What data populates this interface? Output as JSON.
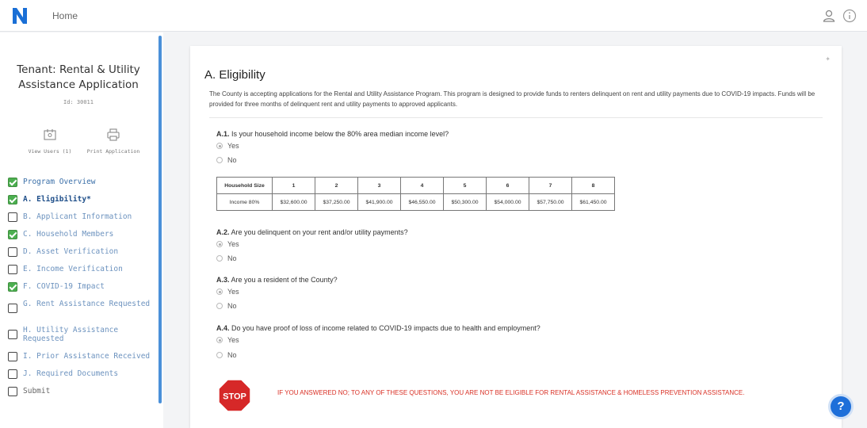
{
  "topbar": {
    "home_label": "Home",
    "user_icon": "user-icon",
    "info_icon": "info-icon",
    "logo_letter": "N"
  },
  "sidebar": {
    "title": "Tenant: Rental & Utility Assistance Application",
    "id_label": "Id: 30011",
    "actions": [
      {
        "label": "View Users (1)",
        "icon": "users-icon"
      },
      {
        "label": "Print Application",
        "icon": "print-icon"
      }
    ],
    "items": [
      {
        "label": "Program Overview",
        "checked": true
      },
      {
        "label": "A. Eligibility*",
        "checked": true,
        "active": true
      },
      {
        "label": "B. Applicant Information",
        "checked": false
      },
      {
        "label": "C. Household Members",
        "checked": true
      },
      {
        "label": "D. Asset Verification",
        "checked": false
      },
      {
        "label": "E. Income Verification",
        "checked": false
      },
      {
        "label": "F. COVID-19 Impact",
        "checked": true
      },
      {
        "label": "G. Rent Assistance Requested",
        "checked": false
      },
      {
        "label": "H. Utility Assistance Requested",
        "checked": false
      },
      {
        "label": "I. Prior Assistance Received",
        "checked": false
      },
      {
        "label": "J. Required Documents",
        "checked": false
      },
      {
        "label": "Submit",
        "checked": false
      }
    ]
  },
  "main": {
    "corner_icon": "collapse-icon",
    "title": "A. Eligibility",
    "description": "The County is accepting applications for the Rental and Utility Assistance Program. This program is designed to provide funds to renters delinquent on rent and utility payments due to COVID-19 impacts. Funds will be provided for three months of delinquent rent and utility payments to approved applicants.",
    "questions": [
      {
        "num": "A.1.",
        "text": " Is your household income below the 80% area median income level?",
        "options": [
          "Yes",
          "No"
        ],
        "selected": "Yes"
      },
      {
        "num": "A.2.",
        "text": " Are you delinquent on your rent and/or utility payments?",
        "options": [
          "Yes",
          "No"
        ],
        "selected": "Yes"
      },
      {
        "num": "A.3.",
        "text": " Are you a resident of the County?",
        "options": [
          "Yes",
          "No"
        ],
        "selected": "Yes"
      },
      {
        "num": "A.4.",
        "text": " Do you have proof of loss of income related to COVID-19 impacts due to health and employment?",
        "options": [
          "Yes",
          "No"
        ],
        "selected": "Yes"
      }
    ],
    "income_table": {
      "headers": [
        "Household Size",
        "1",
        "2",
        "3",
        "4",
        "5",
        "6",
        "7",
        "8"
      ],
      "row": [
        "Income 80%",
        "$32,600.00",
        "$37,250.00",
        "$41,900.00",
        "$46,550.00",
        "$50,300.00",
        "$54,000.00",
        "$57,750.00",
        "$61,450.00"
      ]
    },
    "stop_sign_text": "STOP",
    "warning": "IF YOU ANSWERED NO; TO ANY OF THESE QUESTIONS, YOU ARE NOT BE ELIGIBLE FOR RENTAL ASSISTANCE & HOMELESS PREVENTION ASSISTANCE."
  },
  "help_button": "?",
  "colors": {
    "accent": "#4a90d9",
    "check": "#4caf50",
    "warning": "#d93025",
    "help": "#1e6fd9",
    "stop": "#d62828"
  }
}
